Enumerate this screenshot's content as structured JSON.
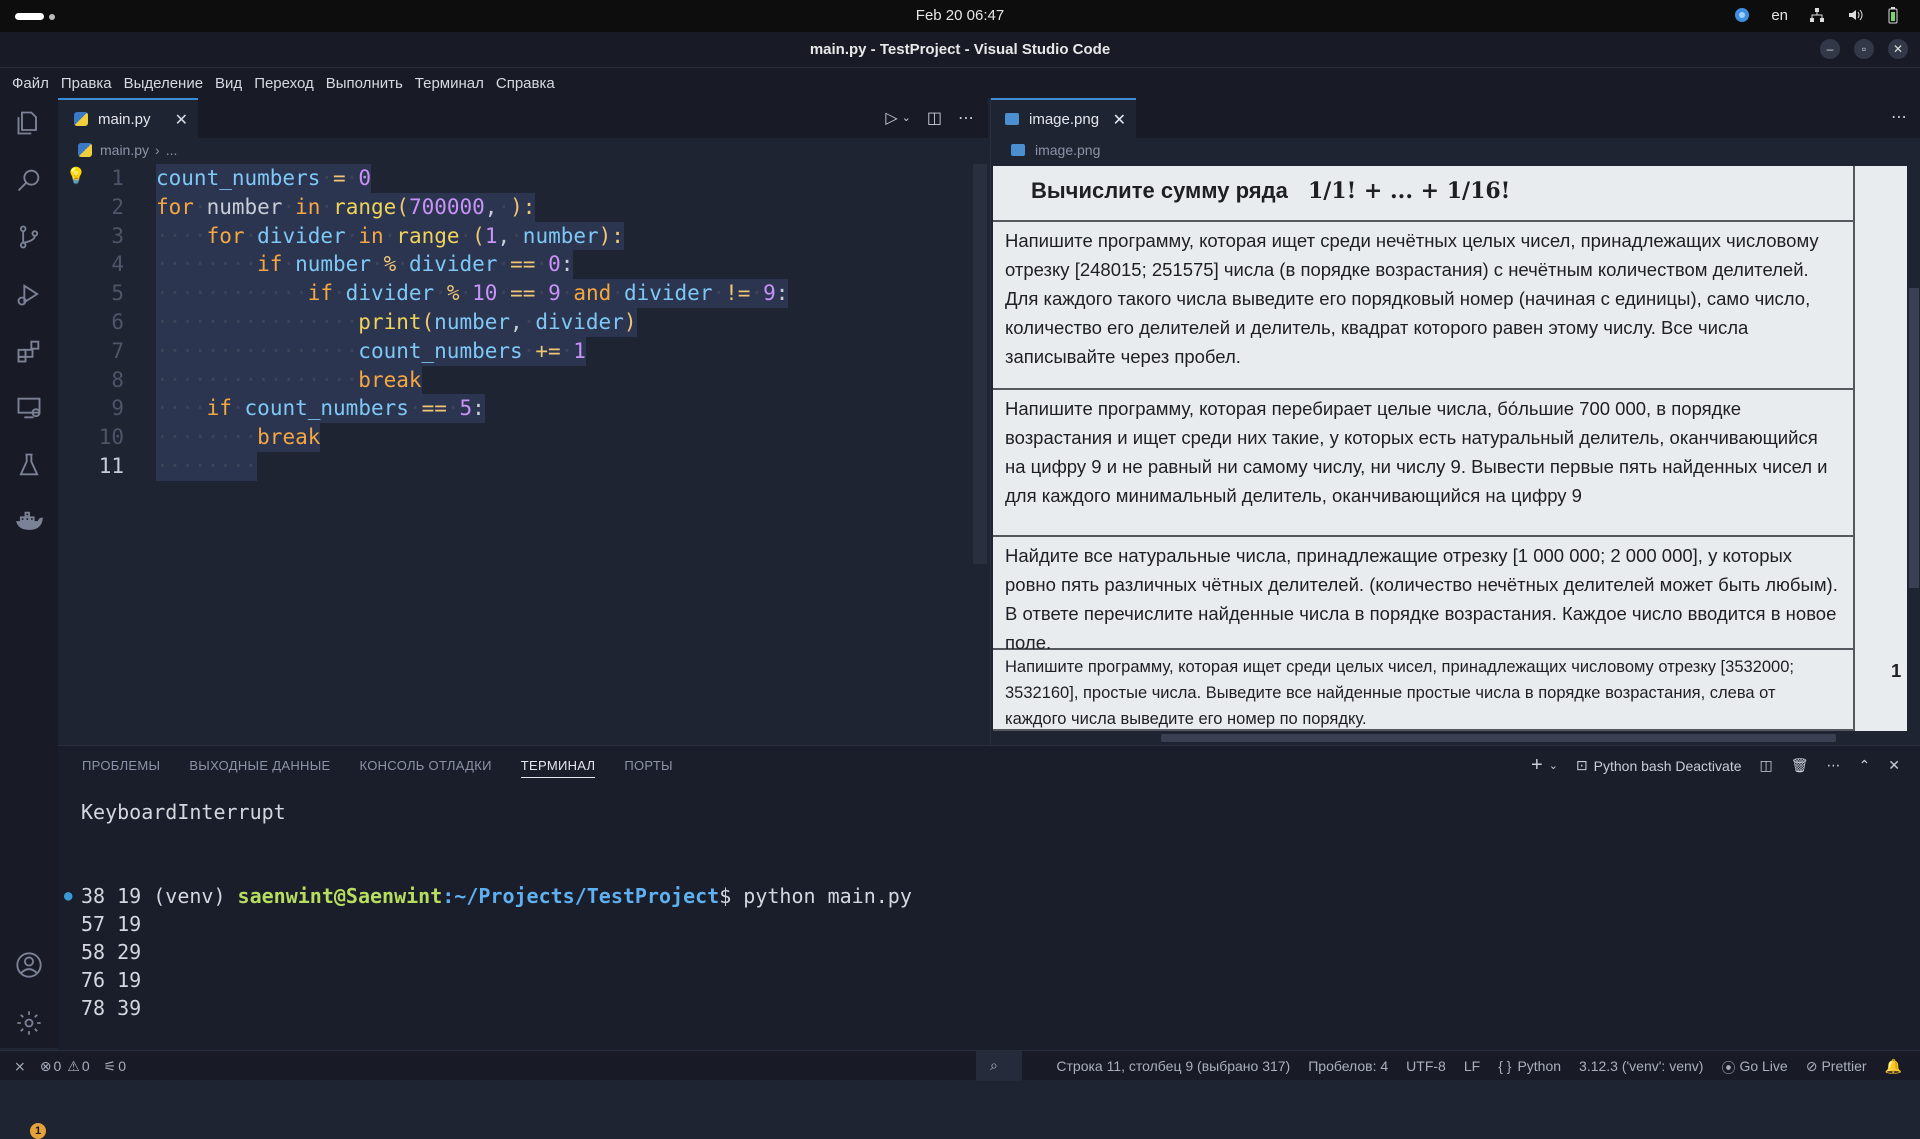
{
  "system": {
    "clock": "Feb 20  06:47",
    "lang": "en"
  },
  "window": {
    "title": "main.py - TestProject - Visual Studio Code"
  },
  "menu": [
    "Файл",
    "Правка",
    "Выделение",
    "Вид",
    "Переход",
    "Выполнить",
    "Терминал",
    "Справка"
  ],
  "editor": {
    "tab": "main.py",
    "breadcrumb_file": "main.py",
    "breadcrumb_more": "...",
    "lines": [
      "1",
      "2",
      "3",
      "4",
      "5",
      "6",
      "7",
      "8",
      "9",
      "10",
      "11"
    ]
  },
  "imageTab": {
    "tab": "image.png",
    "breadcrumb": "image.png"
  },
  "image_text": {
    "row1": "Вычислите сумму ряда",
    "row1_math": "1/1! + ... + 1/16!",
    "row2": "Напишите программу, которая ищет среди нечётных целых чисел, принадлежащих числовому отрезку [248015; 251575] числа (в порядке возрастания) с нечётным количеством делителей. Для каждого такого числа выведите его порядковый номер (начиная с единицы), само число, количество его делителей и делитель, квадрат которого равен этому числу. Все числа записывайте через пробел.",
    "row3": "Напишите программу, которая перебирает целые числа, бо́льшие 700 000, в порядке возрастания и ищет среди них такие, у которых есть натуральный делитель, оканчивающийся на цифру 9 и не равный ни самому числу, ни числу 9. Вывести первые пять найденных чисел и для каждого минимальный делитель, оканчивающийся на цифру 9",
    "row4": "Найдите все натуральные числа, принадлежащие отрезку [1 000 000; 2 000 000], у которых ровно пять различных чётных делителей. (количество нечётных делителей может быть любым). В ответе перечислите найденные числа в порядке возрастания. Каждое число вводится в новое поле.",
    "row5": "Напишите программу, которая ищет среди целых чисел, принадлежащих числовому отрезку [3532000; 3532160], простые числа. Выведите все найденные простые числа в порядке возрастания, слева от каждого числа выведите его номер по порядку.",
    "edge_digit": "1"
  },
  "panel": {
    "tabs": [
      "ПРОБЛЕМЫ",
      "ВЫХОДНЫЕ ДАННЫЕ",
      "КОНСОЛЬ ОТЛАДКИ",
      "ТЕРМИНАЛ",
      "ПОРТЫ"
    ],
    "shell_label": "Python bash Deactivate"
  },
  "terminal": {
    "interrupt": "KeyboardInterrupt",
    "venv": "(venv) ",
    "user": "saenwint@Saenwint",
    "path": ":~/Projects/TestProject",
    "cmd": "$ python main.py",
    "prompt_end": "$ ",
    "output": [
      "38 19",
      "57 19",
      "58 29",
      "76 19",
      "78 39"
    ]
  },
  "status": {
    "errors": "0",
    "warnings": "0",
    "ports": "0",
    "position": "Строка 11, столбец 9 (выбрано 317)",
    "spaces": "Пробелов: 4",
    "encoding": "UTF-8",
    "eol": "LF",
    "language": "Python",
    "interpreter": "3.12.3 ('venv': venv)",
    "golive": "Go Live",
    "prettier": "Prettier",
    "settings_badge": "1"
  }
}
